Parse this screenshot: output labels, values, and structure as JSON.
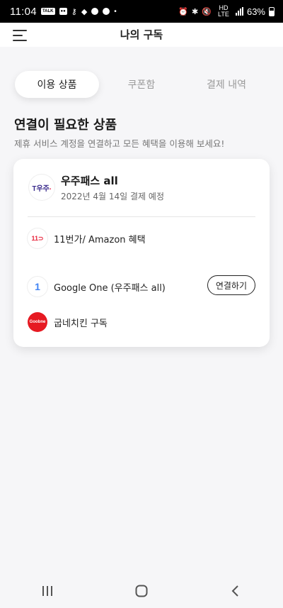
{
  "status_bar": {
    "time": "11:04",
    "left_icons": [
      "talk-icon",
      "kakao-icon",
      "key-icon",
      "sim-icon",
      "gear-icon",
      "c-icon",
      "dot-icon"
    ],
    "network": "HD LTE",
    "battery": "63%"
  },
  "header": {
    "title": "나의 구독"
  },
  "tabs": [
    {
      "label": "이용 상품",
      "active": true
    },
    {
      "label": "쿠폰함",
      "active": false
    },
    {
      "label": "결제 내역",
      "active": false
    }
  ],
  "section": {
    "title": "연결이 필요한 상품",
    "description": "제휴 서비스 계정을 연결하고 모든 혜택을 이용해 보세요!"
  },
  "subscription": {
    "logo_text": "T우주",
    "name": "우주패스 all",
    "payment_date": "2022년 4월 14일 결제 예정"
  },
  "benefits": [
    {
      "icon": "11st-icon",
      "icon_text": "11",
      "label": "11번가/ Amazon 혜택"
    },
    {
      "icon": "google-one-icon",
      "icon_text": "1",
      "label": "Google One (우주패스 all)",
      "action": "연결하기"
    },
    {
      "icon": "goobne-icon",
      "icon_text": "Goobne",
      "label": "굽네치킨 구독"
    }
  ],
  "colors": {
    "background": "#f6f6f8",
    "accent_red": "#e61a22",
    "brand_purple": "#3a2b8c"
  }
}
